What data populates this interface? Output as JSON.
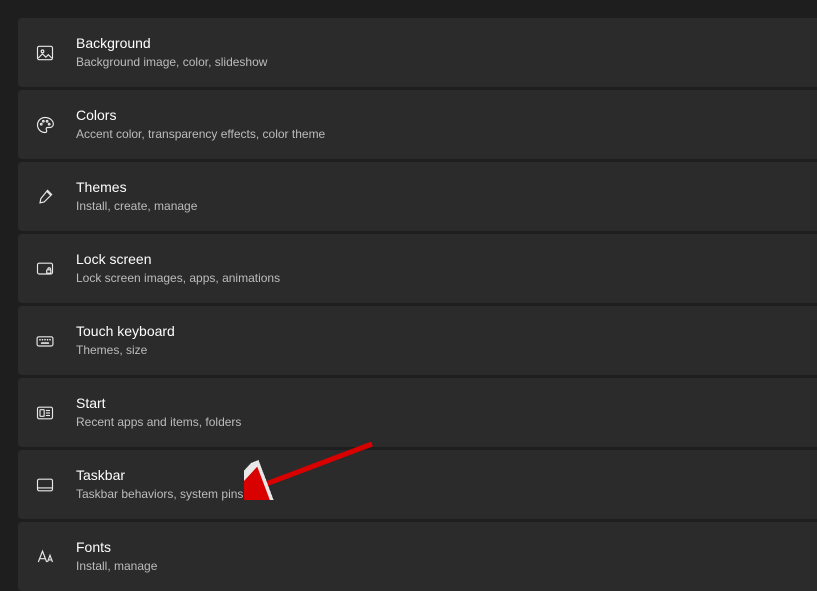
{
  "items": [
    {
      "title": "Background",
      "desc": "Background image, color, slideshow"
    },
    {
      "title": "Colors",
      "desc": "Accent color, transparency effects, color theme"
    },
    {
      "title": "Themes",
      "desc": "Install, create, manage"
    },
    {
      "title": "Lock screen",
      "desc": "Lock screen images, apps, animations"
    },
    {
      "title": "Touch keyboard",
      "desc": "Themes, size"
    },
    {
      "title": "Start",
      "desc": "Recent apps and items, folders"
    },
    {
      "title": "Taskbar",
      "desc": "Taskbar behaviors, system pins"
    },
    {
      "title": "Fonts",
      "desc": "Install, manage"
    }
  ]
}
